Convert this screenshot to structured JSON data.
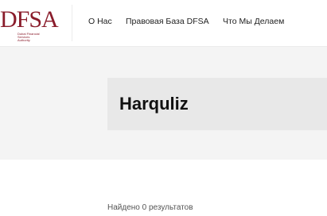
{
  "header": {
    "logo": {
      "text": "DFSA",
      "subtitle_lines": [
        "Dubai Financial",
        "Services",
        "Authority"
      ]
    },
    "nav": [
      {
        "label": "О Нас"
      },
      {
        "label": "Правовая База DFSA"
      },
      {
        "label": "Что Мы Делаем"
      }
    ]
  },
  "hero": {
    "title": "Harquliz"
  },
  "results": {
    "summary": "Найдено 0 результатов"
  },
  "colors": {
    "brand": "#8a1c2b",
    "hero_bg": "#f4f4f4",
    "title_box_bg": "#e8e8e8"
  }
}
